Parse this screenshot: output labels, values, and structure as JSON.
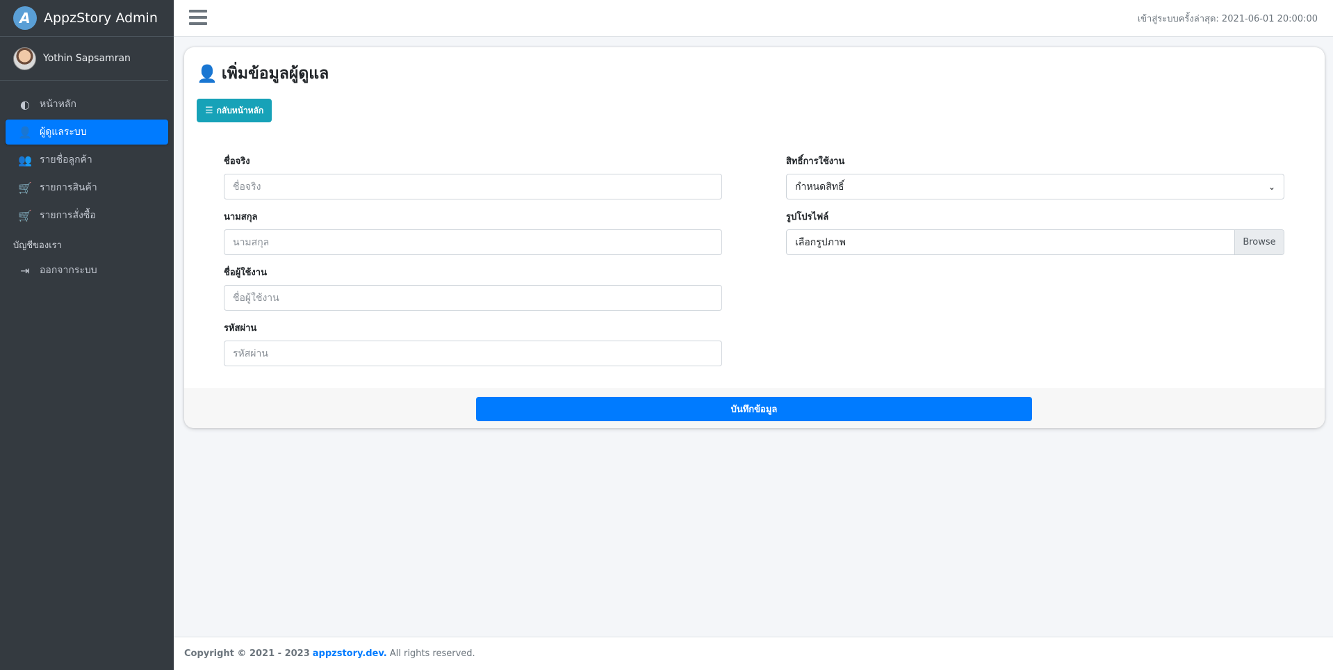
{
  "brand": {
    "logo_letter": "A",
    "name": "AppzStory Admin"
  },
  "user": {
    "name": "Yothin Sapsamran"
  },
  "sidebar": {
    "items": [
      {
        "label": "หน้าหลัก",
        "icon": "dashboard-icon",
        "glyph": "◐",
        "active": false
      },
      {
        "label": "ผู้ดูแลระบบ",
        "icon": "user-cog-icon",
        "glyph": "👤",
        "active": true
      },
      {
        "label": "รายชื่อลูกค้า",
        "icon": "users-icon",
        "glyph": "👥",
        "active": false
      },
      {
        "label": "รายการสินค้า",
        "icon": "cart-icon",
        "glyph": "🛒",
        "active": false
      },
      {
        "label": "รายการสั่งซื้อ",
        "icon": "cart-plus-icon",
        "glyph": "🛒",
        "active": false
      }
    ],
    "section_header": "บัญชีของเรา",
    "logout": {
      "label": "ออกจากระบบ",
      "icon": "sign-out-icon",
      "glyph": "⇥"
    }
  },
  "topbar": {
    "last_login": "เข้าสู่ระบบครั้งล่าสุด: 2021-06-01 20:00:00"
  },
  "card": {
    "title": "เพิ่มข้อมูลผู้ดูแล",
    "back_button": "กลับหน้าหลัก",
    "fields": {
      "first_name": {
        "label": "ชื่อจริง",
        "placeholder": "ชื่อจริง",
        "value": ""
      },
      "last_name": {
        "label": "นามสกุล",
        "placeholder": "นามสกุล",
        "value": ""
      },
      "username": {
        "label": "ชื่อผู้ใช้งาน",
        "placeholder": "ชื่อผู้ใช้งาน",
        "value": ""
      },
      "password": {
        "label": "รหัสผ่าน",
        "placeholder": "รหัสผ่าน",
        "value": ""
      },
      "permission": {
        "label": "สิทธิ์การใช้งาน",
        "selected": "กำหนดสิทธิ์"
      },
      "profile_image": {
        "label": "รูปโปรไฟล์",
        "file_text": "เลือกรูปภาพ",
        "browse": "Browse"
      }
    },
    "save_button": "บันทึกข้อมูล"
  },
  "footer": {
    "copyright": "Copyright © 2021 - 2023",
    "link": "appzstory.dev.",
    "rights": "All rights reserved."
  },
  "colors": {
    "sidebar_bg": "#343a40",
    "primary": "#007bff",
    "info": "#17a2b8"
  }
}
